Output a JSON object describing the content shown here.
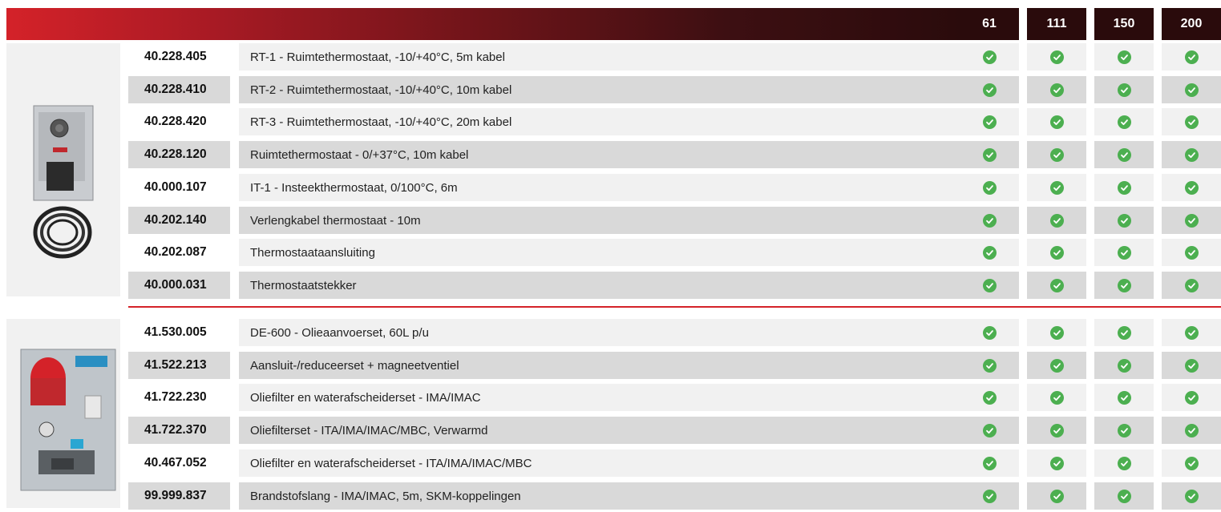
{
  "columns": [
    "61",
    "111",
    "150",
    "200"
  ],
  "colors": {
    "accent": "#d42229",
    "dark": "#2a0b0c",
    "check": "#4caf50",
    "row_alt": "#d9d9d9",
    "row_base": "#f1f1f1"
  },
  "icons": {
    "check": "check-circle-icon"
  },
  "groups": [
    {
      "image": "room-thermostat-unit",
      "rows": [
        {
          "code": "40.228.405",
          "desc": "RT-1 - Ruimtethermostaat, -10/+40°C, 5m kabel",
          "checks": [
            true,
            true,
            true,
            true
          ]
        },
        {
          "code": "40.228.410",
          "desc": "RT-2 - Ruimtethermostaat, -10/+40°C, 10m kabel",
          "checks": [
            true,
            true,
            true,
            true
          ]
        },
        {
          "code": "40.228.420",
          "desc": "RT-3 - Ruimtethermostaat, -10/+40°C, 20m kabel",
          "checks": [
            true,
            true,
            true,
            true
          ]
        },
        {
          "code": "40.228.120",
          "desc": "Ruimtethermostaat - 0/+37°C, 10m kabel",
          "checks": [
            true,
            true,
            true,
            true
          ]
        },
        {
          "code": "40.000.107",
          "desc": "IT-1 - Insteekthermostaat, 0/100°C, 6m",
          "checks": [
            true,
            true,
            true,
            true
          ]
        },
        {
          "code": "40.202.140",
          "desc": "Verlengkabel thermostaat - 10m",
          "checks": [
            true,
            true,
            true,
            true
          ]
        },
        {
          "code": "40.202.087",
          "desc": "Thermostaataansluiting",
          "checks": [
            true,
            true,
            true,
            true
          ]
        },
        {
          "code": "40.000.031",
          "desc": "Thermostaatstekker",
          "checks": [
            true,
            true,
            true,
            true
          ]
        }
      ]
    },
    {
      "image": "oil-supply-set",
      "rows": [
        {
          "code": "41.530.005",
          "desc": "DE-600 - Olieaanvoerset, 60L p/u",
          "checks": [
            true,
            true,
            true,
            true
          ]
        },
        {
          "code": "41.522.213",
          "desc": "Aansluit-/reduceerset + magneetventiel",
          "checks": [
            true,
            true,
            true,
            true
          ]
        },
        {
          "code": "41.722.230",
          "desc": "Oliefilter en waterafscheiderset - IMA/IMAC",
          "checks": [
            true,
            true,
            true,
            true
          ]
        },
        {
          "code": "41.722.370",
          "desc": "Oliefilterset - ITA/IMA/IMAC/MBC, Verwarmd",
          "checks": [
            true,
            true,
            true,
            true
          ]
        },
        {
          "code": "40.467.052",
          "desc": "Oliefilter en waterafscheiderset - ITA/IMA/IMAC/MBC",
          "checks": [
            true,
            true,
            true,
            true
          ]
        },
        {
          "code": "99.999.837",
          "desc": "Brandstofslang - IMA/IMAC, 5m, SKM-koppelingen",
          "checks": [
            true,
            true,
            true,
            true
          ]
        }
      ]
    }
  ]
}
